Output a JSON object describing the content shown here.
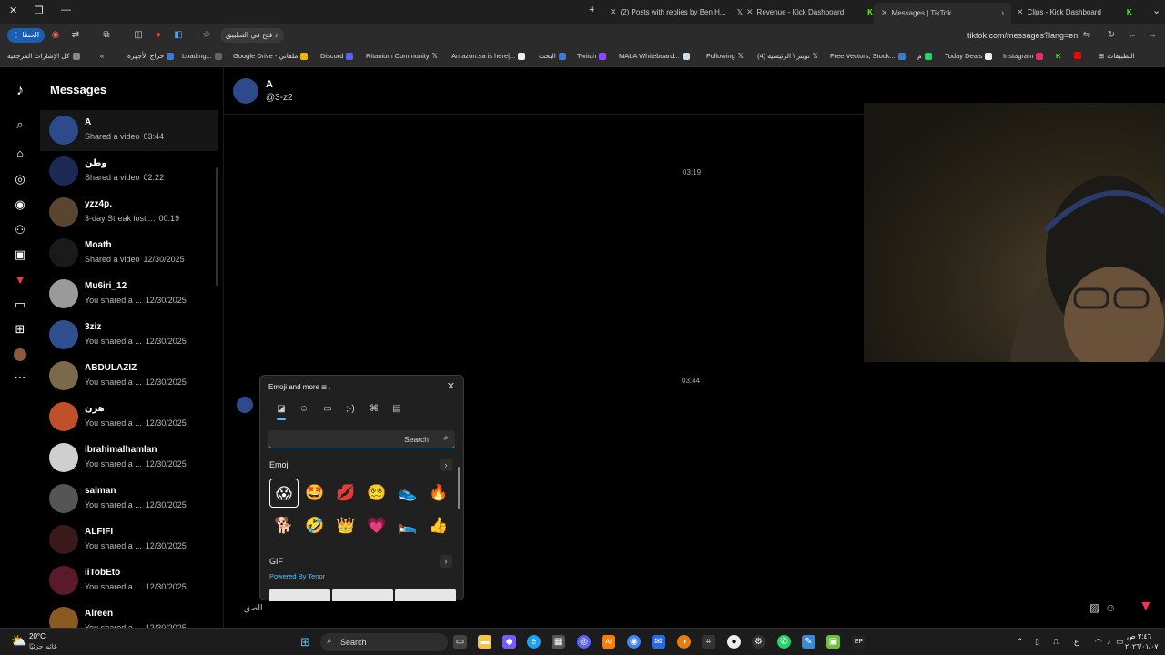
{
  "browser": {
    "tabs": [
      {
        "label": "(2) Posts with replies by Ben H...",
        "active": false
      },
      {
        "label": "Revenue - Kick Dashboard",
        "active": false
      },
      {
        "label": "Messages | TikTok",
        "active": true
      },
      {
        "label": "Clips - Kick Dashboard",
        "active": false
      }
    ],
    "new_tab": "+",
    "open_in_app": "فتح في التطبيق",
    "profile_label": "الحظا",
    "url": "tiktok.com/messages?lang=en",
    "bookmarks": [
      "كل الإشارات المرجعية",
      "حراج الأجهزة",
      "Loading...",
      "Google Drive - ملفاتي",
      "Discord",
      "Ritanium Community",
      "Amazon.sa is here|...",
      "البحث",
      "Twitch",
      "MALA Whiteboard...",
      "Following",
      "تويتر \\ الرئيسية (4)",
      "Free Vectors, Stock...",
      "م",
      "Today Deals",
      "Instagram",
      "التطبيقات"
    ]
  },
  "messages_page": {
    "title": "Messages",
    "conversations": [
      {
        "name": "A",
        "preview": "Shared a video",
        "time": "03:44",
        "avatar_color": "#2d4a8a"
      },
      {
        "name": "وطن",
        "preview": "Shared a video",
        "time": "02:22",
        "avatar_color": "#1c2a55"
      },
      {
        "name": "yzz4p.",
        "preview": "3-day Streak lost ...",
        "time": "00:19",
        "avatar_color": "#5a4630"
      },
      {
        "name": "Moath",
        "preview": "Shared a video",
        "time": "12/30/2025",
        "avatar_color": "#1a1a1a"
      },
      {
        "name": "Mu6iri_12",
        "preview": "You shared a ...",
        "time": "12/30/2025",
        "avatar_color": "#9a9a9a"
      },
      {
        "name": "3ziz",
        "preview": "You shared a ...",
        "time": "12/30/2025",
        "avatar_color": "#2f4f8f"
      },
      {
        "name": "ABDULAZIZ",
        "preview": "You shared a ...",
        "time": "12/30/2025",
        "avatar_color": "#7a6a4a"
      },
      {
        "name": "هزن",
        "preview": "You shared a ...",
        "time": "12/30/2025",
        "avatar_color": "#c0502a"
      },
      {
        "name": "ibrahimalhamlan",
        "preview": "You shared a ...",
        "time": "12/30/2025",
        "avatar_color": "#cfcfcf"
      },
      {
        "name": "salman",
        "preview": "You shared a ...",
        "time": "12/30/2025",
        "avatar_color": "#555"
      },
      {
        "name": "ALFIFI",
        "preview": "You shared a ...",
        "time": "12/30/2025",
        "avatar_color": "#3a1a1a"
      },
      {
        "name": "iiTobEto",
        "preview": "You shared a ...",
        "time": "12/30/2025",
        "avatar_color": "#5a1a2a"
      },
      {
        "name": "Alreen",
        "preview": "You shared a ...",
        "time": "12/30/2025",
        "avatar_color": "#8a5a20"
      }
    ],
    "chat": {
      "name": "A",
      "handle": "@3-z2",
      "timestamps": [
        "03:19",
        "03:44"
      ],
      "input_placeholder": "الصق"
    }
  },
  "emoji_panel": {
    "title": "Emoji and more",
    "search_placeholder": "Search",
    "sections": {
      "emoji": "Emoji",
      "gif": "GIF"
    },
    "powered_by": "Powered By Tenor",
    "emojis": [
      "😱",
      "🤩",
      "💋",
      "😵‍💫",
      "👟",
      "🔥",
      "🐕",
      "🤣",
      "👑",
      "💗",
      "🛌",
      "👍"
    ],
    "selected_index": 0
  },
  "taskbar": {
    "weather_temp": "20°C",
    "weather_desc": "غائم جزئيًا",
    "search_label": "Search",
    "time": "٣:٤٦ ص",
    "date": "٢٠٢٦/٠١/٠٧",
    "lang": "ع"
  },
  "colors": {
    "accent_blue": "#4cc2ff",
    "tiktok_red": "#fe2c55",
    "background": "#000000"
  }
}
